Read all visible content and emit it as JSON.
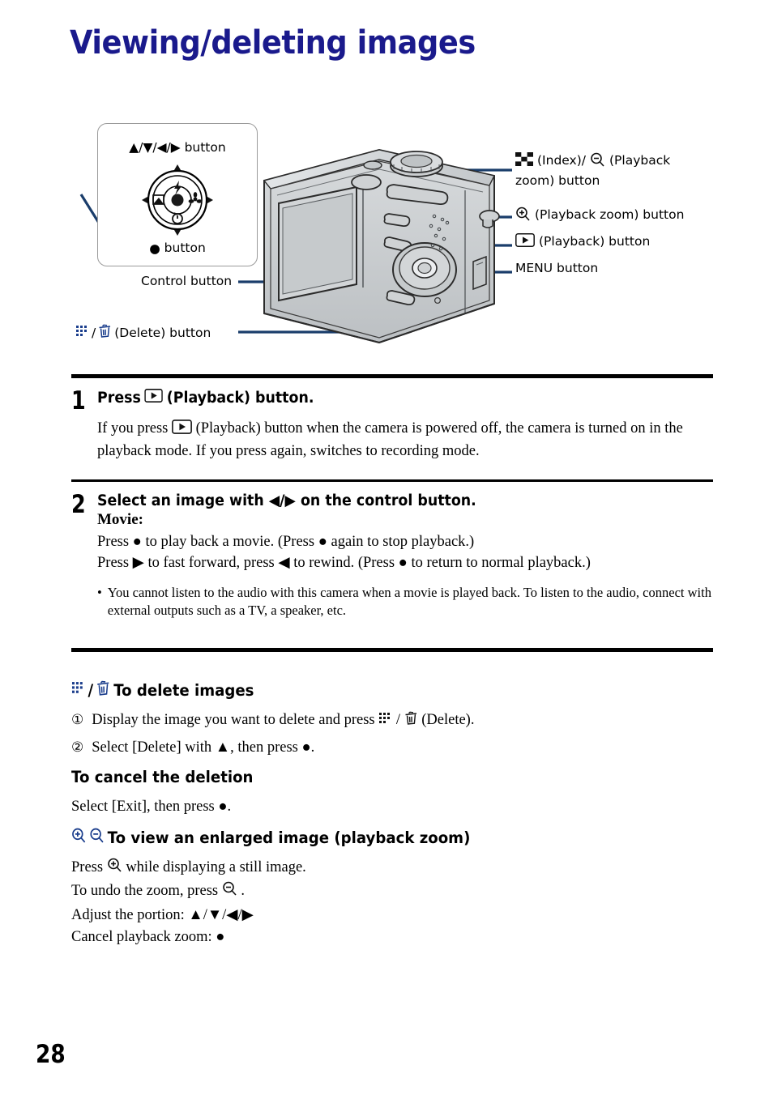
{
  "document": {
    "title": "Viewing/deleting images",
    "page_number": "28"
  },
  "colors": {
    "title_blue": "#1a1a8c",
    "leader_navy": "#1a3d6b",
    "icon_blue": "#1a3d8c",
    "camera_body": "#c9ccce",
    "box_border": "#9a9a9a"
  },
  "diagram": {
    "control_box": {
      "title": "▲/▼/◀/▶ button",
      "center_label": "button",
      "wheel_icons": [
        "flash-icon",
        "macro-icon",
        "exposure-icon",
        "self-timer-icon",
        "center-button"
      ]
    },
    "labels": {
      "control_button": "Control button",
      "delete_button": "(Delete) button"
    },
    "callouts": [
      {
        "name": "index-playback-zoom-out",
        "text": "(Index)/",
        "text2": "(Playback",
        "text3": "zoom) button"
      },
      {
        "name": "playback-zoom-in",
        "text": "(Playback zoom) button"
      },
      {
        "name": "playback",
        "text": "(Playback) button"
      },
      {
        "name": "menu",
        "text": "MENU button"
      }
    ]
  },
  "steps": [
    {
      "number": "1",
      "head_pre": "Press",
      "head_post": "(Playback) button.",
      "body_pre": "If you press",
      "body_post": "(Playback) button when the camera is powered off, the camera is turned on in the playback mode. If you press again, switches to recording mode."
    },
    {
      "number": "2",
      "head": "Select an image with ◀/▶ on the control button.",
      "movie_label": "Movie:",
      "line1": "Press ● to play back a movie. (Press ● again to stop playback.)",
      "line2": "Press ▶ to fast forward, press ◀ to rewind. (Press ● to return to normal playback.)",
      "note_bullet": "•",
      "note": "You cannot listen to the audio with this camera when a movie is played back. To listen to the audio, connect with external outputs such as a TV, a speaker, etc."
    }
  ],
  "sections": {
    "delete": {
      "heading": "To delete images",
      "items": [
        {
          "num": "①",
          "pre": "Display the image you want to delete and press",
          "post": "(Delete)."
        },
        {
          "num": "②",
          "text": "Select [Delete] with ▲, then press ●."
        }
      ]
    },
    "cancel": {
      "heading": "To cancel the deletion",
      "text": "Select [Exit], then press ●."
    },
    "zoom": {
      "heading": "To view an enlarged image (playback zoom)",
      "line1_pre": "Press",
      "line1_post": "while displaying a still image.",
      "line2_pre": "To undo the zoom, press",
      "line2_post": ".",
      "line3": "Adjust the portion: ▲/▼/◀/▶",
      "line4": "Cancel playback zoom: ●"
    }
  }
}
